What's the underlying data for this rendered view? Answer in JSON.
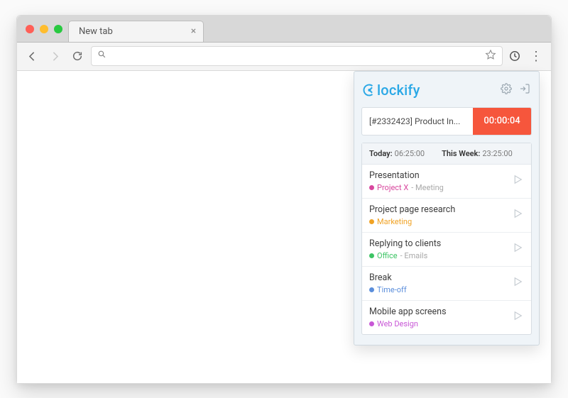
{
  "browser": {
    "tab_title": "New tab",
    "omnibox_placeholder": ""
  },
  "popup": {
    "app_name": "lockify",
    "tracker": {
      "description": "[#2332423] Product In...",
      "elapsed": "00:00:04"
    },
    "summary": {
      "today_label": "Today:",
      "today_value": "06:25:00",
      "week_label": "This Week:",
      "week_value": "23:25:00"
    },
    "entries": [
      {
        "title": "Presentation",
        "project": "Project X",
        "task": "Meeting",
        "color": "#d8479e"
      },
      {
        "title": "Project page research",
        "project": "Marketing",
        "task": "",
        "color": "#f0a224"
      },
      {
        "title": "Replying to clients",
        "project": "Office",
        "task": "Emails",
        "color": "#3cc464"
      },
      {
        "title": "Break",
        "project": "Time-off",
        "task": "",
        "color": "#5b8edb"
      },
      {
        "title": "Mobile app screens",
        "project": "Web Design",
        "task": "",
        "color": "#c857d6"
      }
    ]
  }
}
